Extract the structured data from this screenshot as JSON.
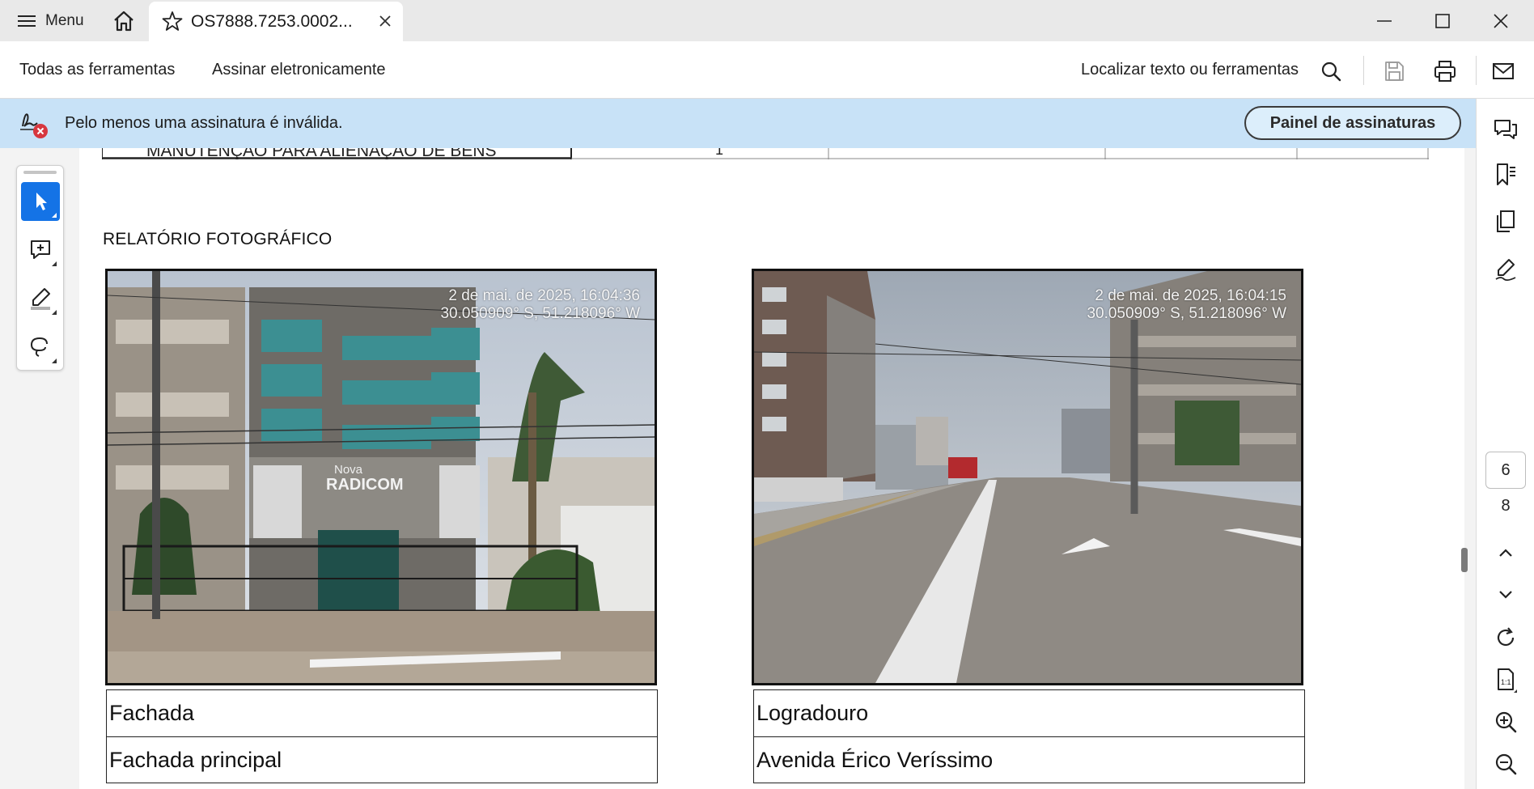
{
  "titlebar": {
    "menu_label": "Menu",
    "tab_title": "OS7888.7253.0002...",
    "icons": [
      "hamburger-icon",
      "home-icon",
      "star-icon",
      "close-tab-icon",
      "minimize-icon",
      "maximize-icon",
      "close-window-icon"
    ]
  },
  "toolbar": {
    "all_tools": "Todas as ferramentas",
    "sign_electronically": "Assinar eletronicamente",
    "find_placeholder": "Localizar texto ou ferramentas",
    "icons": [
      "search-icon",
      "save-icon",
      "print-icon",
      "mail-icon"
    ]
  },
  "signature_banner": {
    "message": "Pelo menos uma assinatura é inválida.",
    "panel_button": "Painel de assinaturas",
    "status_color": "#d7373f",
    "background_color": "#c8e2f7"
  },
  "tool_palette": {
    "tools": [
      "select-tool",
      "add-comment-tool",
      "highlight-tool",
      "draw-tool"
    ],
    "active": "select-tool",
    "accent_color": "#1473e6"
  },
  "right_rail": {
    "icons": [
      "comments-icon",
      "bookmarks-icon",
      "pages-icon",
      "fill-sign-icon",
      "chevron-up-icon",
      "chevron-down-icon",
      "rotate-icon",
      "fit-page-icon",
      "zoom-in-icon",
      "zoom-out-icon"
    ],
    "current_page": "6",
    "total_pages": "8"
  },
  "document": {
    "previous_table_fragment": "MANUTENÇÃO PARA ALIENAÇÃO DE BENS",
    "previous_table_cell": "1",
    "heading": "RELATÓRIO FOTOGRÁFICO",
    "photos": [
      {
        "stamp_line1": "2 de mai. de 2025, 16:04:36",
        "stamp_line2": "30.050909° S, 51.218096° W",
        "sign_line1": "Nova",
        "sign_line2": "RADICOM",
        "caption_label": "Fachada",
        "caption_value": "Fachada principal"
      },
      {
        "stamp_line1": "2 de mai. de 2025, 16:04:15",
        "stamp_line2": "30.050909° S, 51.218096° W",
        "caption_label": "Logradouro",
        "caption_value": "Avenida Érico Veríssimo"
      }
    ]
  }
}
